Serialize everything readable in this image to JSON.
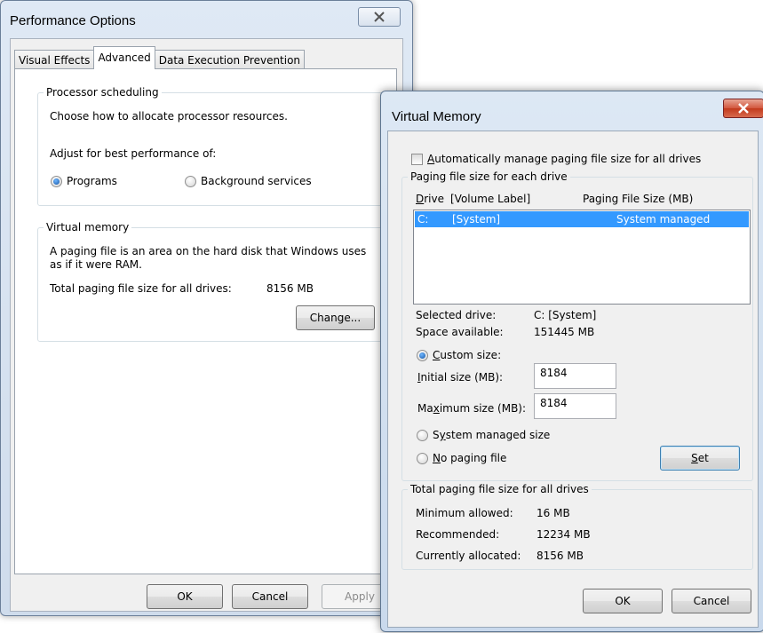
{
  "perf": {
    "title": "Performance Options",
    "tabs": [
      "Visual Effects",
      "Advanced",
      "Data Execution Prevention"
    ],
    "processor": {
      "legend": "Processor scheduling",
      "desc": "Choose how to allocate processor resources.",
      "adjust": "Adjust for best performance of:",
      "opt_programs": "Programs",
      "opt_background": "Background services",
      "selected": "Programs"
    },
    "virtual": {
      "legend": "Virtual memory",
      "desc_line1": "A paging file is an area on the hard disk that Windows uses",
      "desc_line2": "as if it were RAM.",
      "total_label": "Total paging file size for all drives:",
      "total_value": "8156 MB",
      "change_label": "Change..."
    },
    "buttons": {
      "ok": "OK",
      "cancel": "Cancel",
      "apply": "Apply"
    }
  },
  "vm": {
    "title": "Virtual Memory",
    "auto_manage": {
      "pre": "",
      "accel": "A",
      "post": "utomatically manage paging file size for all drives",
      "checked": false
    },
    "drives_legend": "Paging file size for each drive",
    "col_drive": {
      "accel": "D",
      "post": "rive"
    },
    "col_volume": "[Volume Label]",
    "col_size": "Paging File Size (MB)",
    "drives": [
      {
        "drive": "C:",
        "label": "[System]",
        "size": "System managed",
        "selected": true
      }
    ],
    "selected_drive_label": "Selected drive:",
    "selected_drive_value": "C:  [System]",
    "space_label": "Space available:",
    "space_value": "151445 MB",
    "custom": {
      "accel": "C",
      "post": "ustom size:",
      "checked": true
    },
    "initial": {
      "accel": "I",
      "post": "nitial size (MB):",
      "value": "8184"
    },
    "maximum": {
      "pre": "Ma",
      "accel": "x",
      "post": "imum size (MB):",
      "value": "8184"
    },
    "system_managed": {
      "pre": "S",
      "accel": "y",
      "post": "stem managed size",
      "checked": false
    },
    "no_paging": {
      "accel": "N",
      "post": "o paging file",
      "checked": false
    },
    "set": {
      "accel": "S",
      "post": "et"
    },
    "totals": {
      "legend": "Total paging file size for all drives",
      "min_label": "Minimum allowed:",
      "min_value": "16 MB",
      "rec_label": "Recommended:",
      "rec_value": "12234 MB",
      "cur_label": "Currently allocated:",
      "cur_value": "8156 MB"
    },
    "buttons": {
      "ok": "OK",
      "cancel": "Cancel"
    }
  }
}
